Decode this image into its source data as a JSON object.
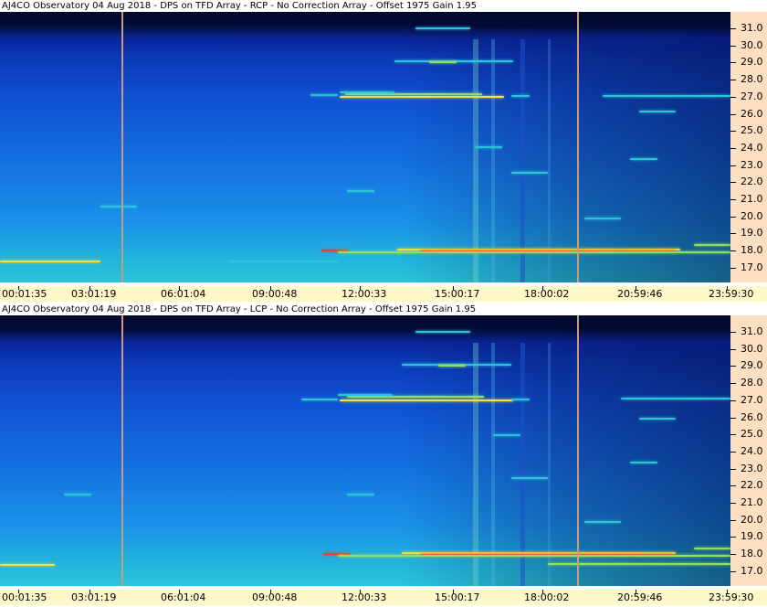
{
  "panels": [
    {
      "title": "AJ4CO Observatory 04 Aug 2018 - DPS on TFD Array  - RCP  -  No Correction Array  -  Offset 1975  Gain 1.95",
      "polarization": "RCP"
    },
    {
      "title": "AJ4CO Observatory 04 Aug 2018 - DPS on TFD Array  - LCP  -  No Correction Array  -  Offset 1975  Gain 1.95",
      "polarization": "LCP"
    }
  ],
  "freq_labels": [
    "31.0",
    "30.0",
    "29.0",
    "28.0",
    "27.0",
    "26.0",
    "25.0",
    "24.0",
    "23.0",
    "22.0",
    "21.0",
    "20.0",
    "19.0",
    "18.0",
    "17.0"
  ],
  "time_labels": [
    "00:01:35",
    "03:01:19",
    "06:01:04",
    "09:00:48",
    "12:00:33",
    "15:00:17",
    "18:00:02",
    "20:59:46",
    "23:59:30"
  ],
  "colors": {
    "deep": "#02082a",
    "dark_blue": "#0a2ea8",
    "blue": "#0f56d8",
    "light_blue": "#1a8ae8",
    "cyan": "#2cc4d8",
    "green": "#8ee060",
    "yellow": "#f0e040",
    "red": "#e8402a",
    "axis_bg": "#fde0c2",
    "time_bg": "#fff8c8",
    "marker": "#c99a7e"
  }
}
